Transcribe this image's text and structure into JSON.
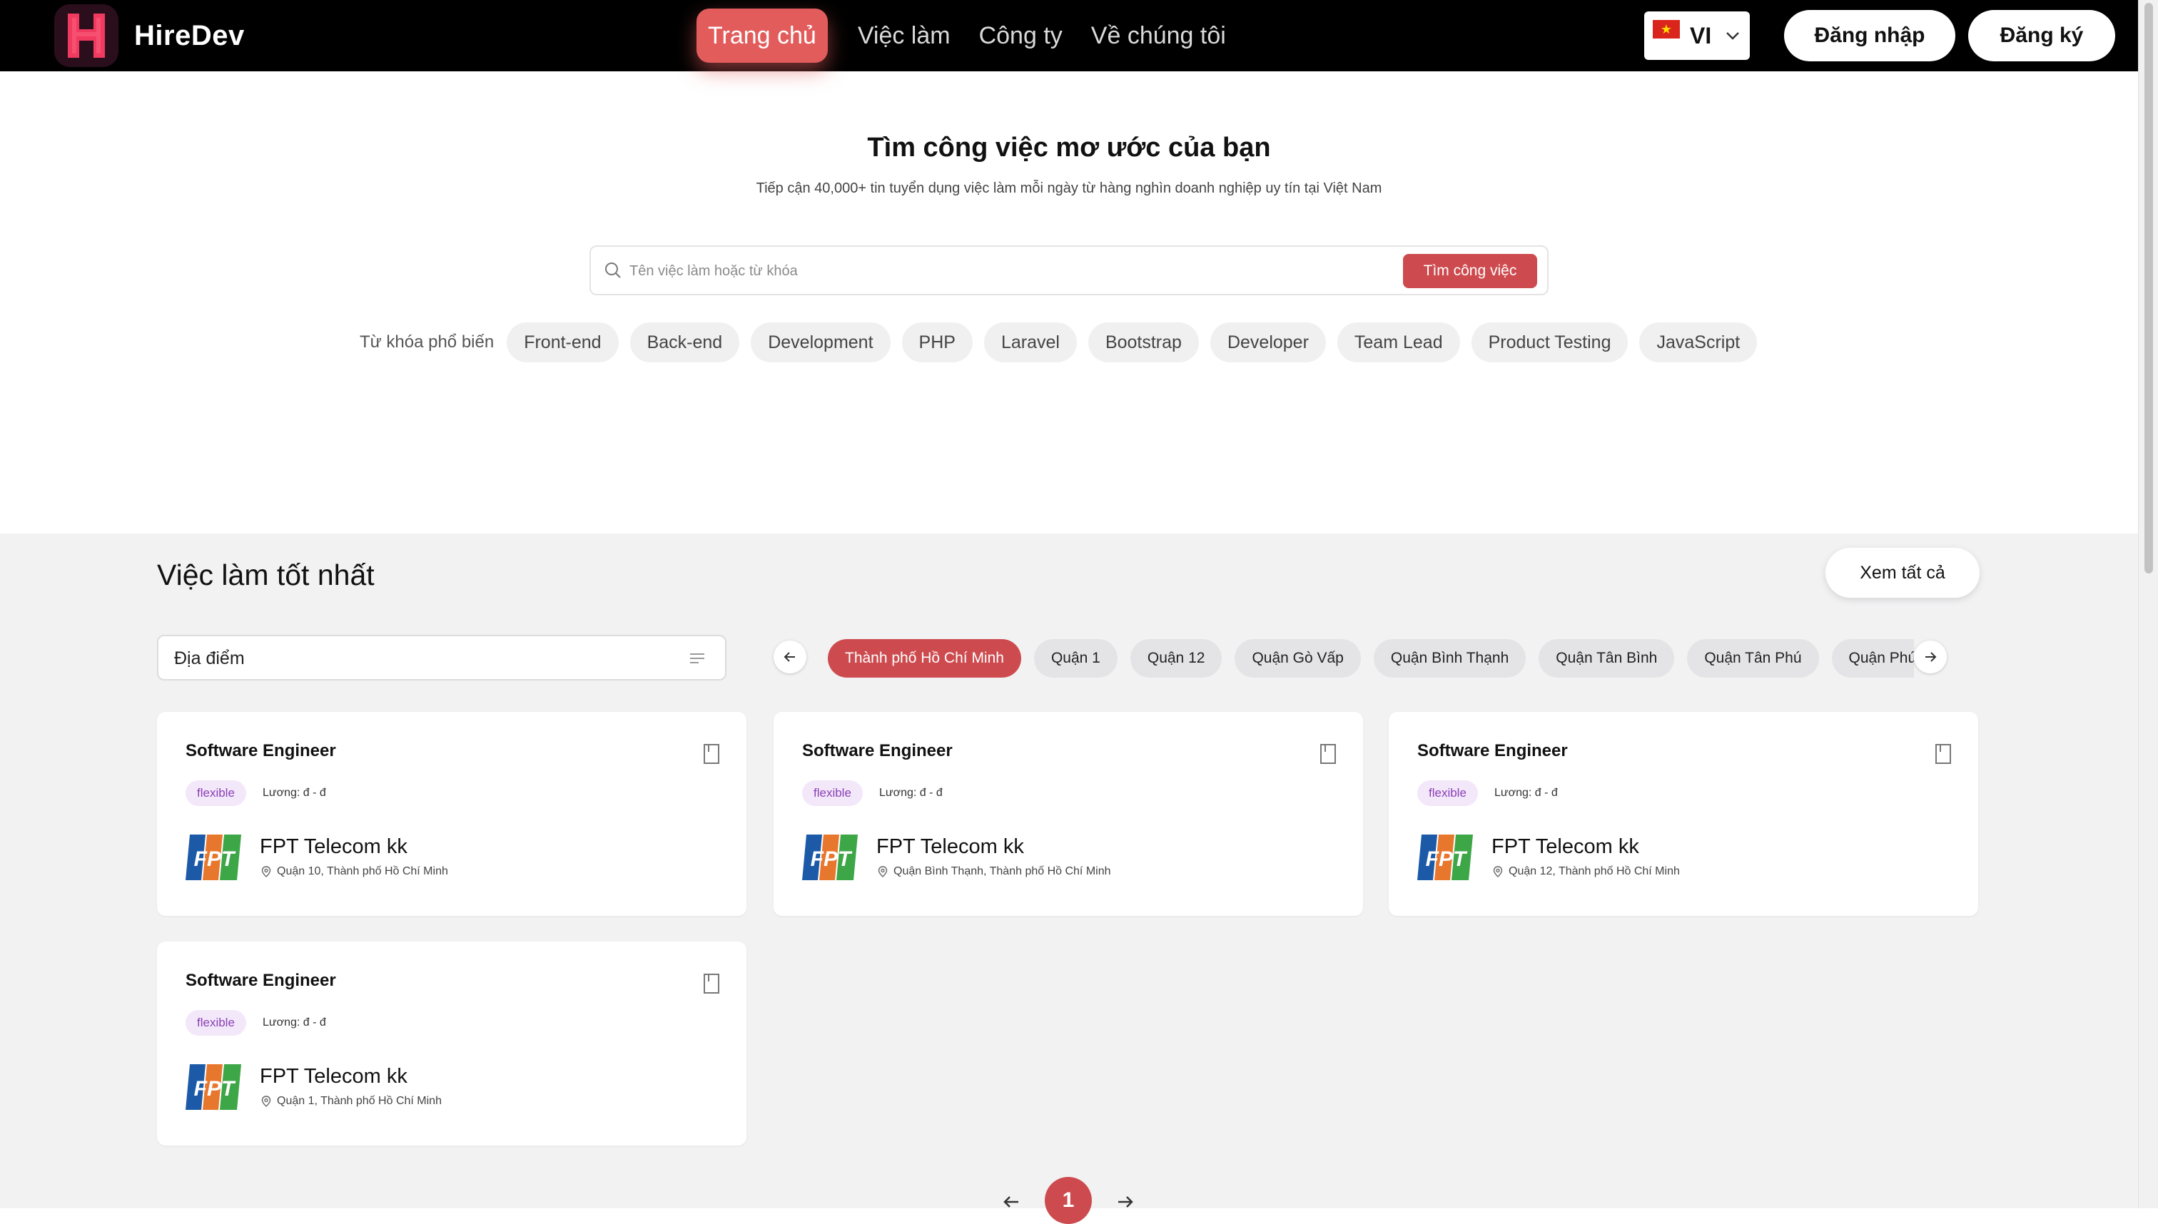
{
  "header": {
    "logo_letter": "H",
    "brand": "HireDev",
    "nav": [
      {
        "label": "Trang chủ",
        "active": true
      },
      {
        "label": "Việc làm",
        "active": false
      },
      {
        "label": "Công ty",
        "active": false
      },
      {
        "label": "Về chúng tôi",
        "active": false
      }
    ],
    "language": {
      "code": "VI",
      "flag": "vietnam-flag-icon"
    },
    "login_label": "Đăng nhập",
    "register_label": "Đăng ký"
  },
  "hero": {
    "title": "Tìm công việc mơ ước của bạn",
    "subtitle": "Tiếp cận 40,000+ tin tuyển dụng việc làm mỗi ngày từ hàng nghìn doanh nghiệp uy tín tại Việt Nam",
    "search_placeholder": "Tên việc làm hoặc từ khóa",
    "search_button": "Tìm công việc",
    "keywords_label": "Từ khóa phổ biến",
    "keywords": [
      "Front-end",
      "Back-end",
      "Development",
      "PHP",
      "Laravel",
      "Bootstrap",
      "Developer",
      "Team Lead",
      "Product Testing",
      "JavaScript"
    ]
  },
  "jobs": {
    "title": "Việc làm tốt nhất",
    "view_all": "Xem tất cả",
    "location_label": "Địa điểm",
    "locations": [
      {
        "label": "Thành phố Hồ Chí Minh",
        "active": true
      },
      {
        "label": "Quận 1",
        "active": false
      },
      {
        "label": "Quận 12",
        "active": false
      },
      {
        "label": "Quận Gò Vấp",
        "active": false
      },
      {
        "label": "Quận Bình Thạnh",
        "active": false
      },
      {
        "label": "Quận Tân Bình",
        "active": false
      },
      {
        "label": "Quận Tân Phú",
        "active": false
      },
      {
        "label": "Quận Phú Nhuận",
        "active": false
      }
    ],
    "cards": [
      {
        "title": "Software Engineer",
        "tag": "flexible",
        "salary": "Lương: đ - đ",
        "company": "FPT Telecom kk",
        "location": "Quận 10, Thành phố Hồ Chí Minh"
      },
      {
        "title": "Software Engineer",
        "tag": "flexible",
        "salary": "Lương: đ - đ",
        "company": "FPT Telecom kk",
        "location": "Quận Bình Thạnh, Thành phố Hồ Chí Minh"
      },
      {
        "title": "Software Engineer",
        "tag": "flexible",
        "salary": "Lương: đ - đ",
        "company": "FPT Telecom kk",
        "location": "Quận 12, Thành phố Hồ Chí Minh"
      },
      {
        "title": "Software Engineer",
        "tag": "flexible",
        "salary": "Lương: đ - đ",
        "company": "FPT Telecom kk",
        "location": "Quận 1, Thành phố Hồ Chí Minh"
      }
    ],
    "company_logo_text": "FPT"
  },
  "pagination": {
    "current": "1"
  },
  "colors": {
    "accent": "#cd4b4f",
    "nav_active": "#e25c5c",
    "header_bg": "#000000",
    "tag_bg": "#f3e8fa",
    "tag_text": "#8a3fb5"
  }
}
